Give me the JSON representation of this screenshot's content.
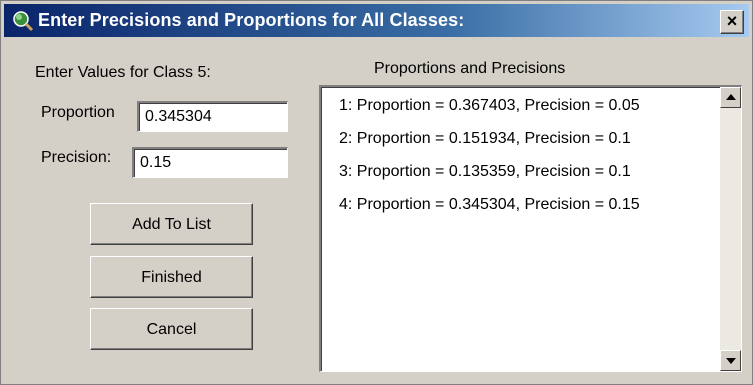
{
  "window": {
    "title": "Enter Precisions and Proportions for All Classes:",
    "close_label": "×",
    "icon": "magnifier-globe-icon"
  },
  "form": {
    "heading": "Enter Values for Class 5:",
    "proportion_label": "Proportion",
    "proportion_value": "0.345304",
    "precision_label": "Precision:",
    "precision_value": "0.15"
  },
  "buttons": {
    "add": "Add To List",
    "finished": "Finished",
    "cancel": "Cancel"
  },
  "list": {
    "heading": "Proportions and Precisions",
    "items": [
      "1: Proportion = 0.367403, Precision = 0.05",
      "2: Proportion = 0.151934, Precision = 0.1",
      "3: Proportion = 0.135359, Precision = 0.1",
      "4: Proportion = 0.345304, Precision = 0.15"
    ]
  }
}
